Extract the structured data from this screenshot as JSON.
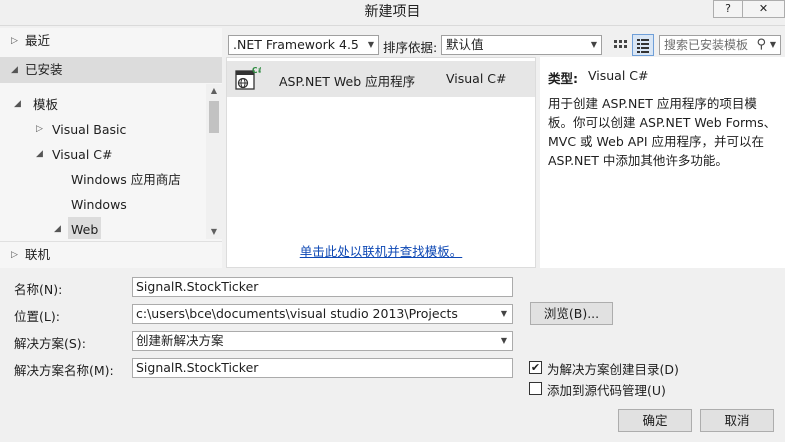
{
  "window": {
    "title": "新建项目",
    "help_label": "?",
    "close_label": "✕"
  },
  "sidebar": {
    "recent": "最近",
    "installed": "已安装",
    "templates": "模板",
    "visual_basic": "Visual Basic",
    "visual_csharp": "Visual C#",
    "windows_store": "Windows 应用商店",
    "windows": "Windows",
    "web": "Web",
    "online": "联机"
  },
  "toolbar": {
    "framework": ".NET Framework 4.5",
    "sort_label": "排序依据:",
    "sort_value": "默认值",
    "search_placeholder": "搜索已安装模板"
  },
  "templates": [
    {
      "name": "ASP.NET Web 应用程序",
      "language": "Visual C#"
    }
  ],
  "center": {
    "online_link": "单击此处以联机并查找模板。"
  },
  "details": {
    "type_label": "类型:",
    "type_value": "Visual C#",
    "description": "用于创建 ASP.NET 应用程序的项目模板。你可以创建 ASP.NET Web Forms、MVC 或 Web API 应用程序，并可以在 ASP.NET 中添加其他许多功能。"
  },
  "form": {
    "name_label": "名称(N):",
    "name_value": "SignalR.StockTicker",
    "location_label": "位置(L):",
    "location_value": "c:\\users\\bce\\documents\\visual studio 2013\\Projects",
    "browse_label": "浏览(B)...",
    "solution_label": "解决方案(S):",
    "solution_value": "创建新解决方案",
    "solution_name_label": "解决方案名称(M):",
    "solution_name_value": "SignalR.StockTicker",
    "create_dir_label": "为解决方案创建目录(D)",
    "create_dir_checked": true,
    "source_control_label": "添加到源代码管理(U)",
    "source_control_checked": false,
    "ok_label": "确定",
    "cancel_label": "取消"
  },
  "icons": {
    "tree_collapsed": "▷",
    "tree_expanded": "◢",
    "dropdown": "▼",
    "search": "⚲"
  }
}
